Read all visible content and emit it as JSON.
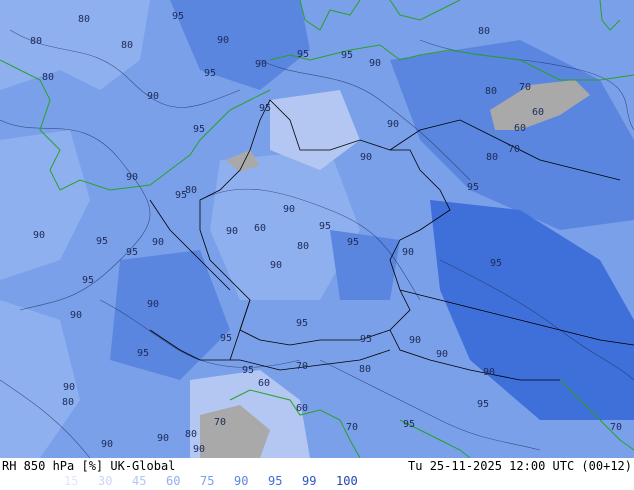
{
  "footer": {
    "product": "RH 850 hPa [%] UK-Global",
    "valid_time": "Tu 25-11-2025 12:00 UTC (00+12)"
  },
  "legend": [
    {
      "label": "15",
      "color": "#dfe7f7"
    },
    {
      "label": "30",
      "color": "#c9d7f5"
    },
    {
      "label": "45",
      "color": "#b3c7f2"
    },
    {
      "label": "60",
      "color": "#8fb0ef"
    },
    {
      "label": "75",
      "color": "#7aa0ea"
    },
    {
      "label": "90",
      "color": "#5a86e0"
    },
    {
      "label": "95",
      "color": "#3f6fd9"
    },
    {
      "label": "99",
      "color": "#2a58c8"
    },
    {
      "label": "100",
      "color": "#1e46b0"
    }
  ],
  "colors": {
    "low_rh": "#b9c9e6",
    "mid_rh": "#8fb0ef",
    "high_rh": "#5a86e0",
    "very_high_rh": "#3f6fd9",
    "dry_gray": "#a9a9a9",
    "coastline": "#2aa02a",
    "borders": "#000000",
    "isolines": "#1d2a57"
  },
  "contour_labels": [
    "80",
    "95",
    "80",
    "90",
    "80",
    "95",
    "90",
    "95",
    "80",
    "90",
    "80",
    "95",
    "90",
    "95",
    "95",
    "90",
    "80",
    "70",
    "60",
    "60",
    "70",
    "80",
    "90",
    "95",
    "90",
    "80",
    "95",
    "90",
    "95",
    "95",
    "90",
    "90",
    "90",
    "60",
    "80",
    "95",
    "95",
    "90",
    "90",
    "95",
    "95",
    "90",
    "95",
    "90",
    "95",
    "95",
    "90",
    "90",
    "80",
    "95",
    "70",
    "60",
    "95",
    "60",
    "70",
    "80",
    "90",
    "95",
    "90",
    "95",
    "90",
    "90",
    "70",
    "90",
    "80",
    "70"
  ]
}
